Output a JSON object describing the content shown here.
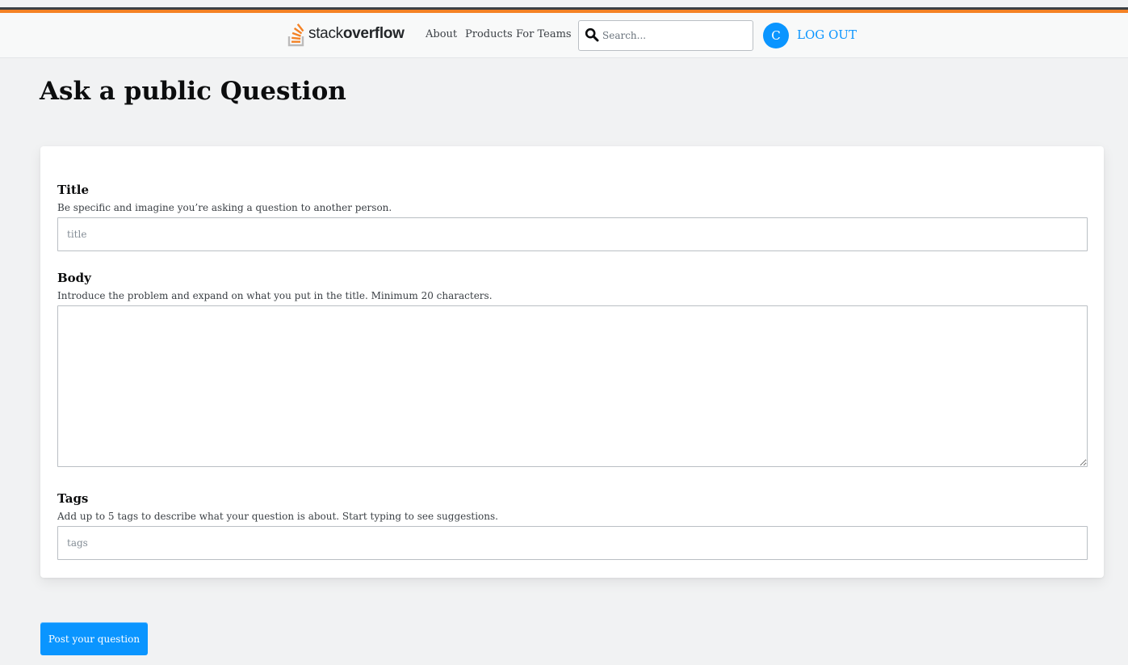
{
  "header": {
    "logo": {
      "regular": "stack",
      "bold": "overflow"
    },
    "nav": [
      "About",
      "Products",
      "For Teams"
    ],
    "search": {
      "placeholder": "Search...",
      "value": ""
    },
    "avatar_letter": "C",
    "logout_label": "LOG OUT"
  },
  "page": {
    "title": "Ask a public Question"
  },
  "form": {
    "title": {
      "label": "Title",
      "description": "Be specific and imagine you’re asking a question to another person.",
      "placeholder": "title"
    },
    "body": {
      "label": "Body",
      "description": "Introduce the problem and expand on what you put in the title. Minimum 20 characters.",
      "placeholder": ""
    },
    "tags": {
      "label": "Tags",
      "description": "Add up to 5 tags to describe what your question is about. Start typing to see suggestions.",
      "placeholder": "tags"
    }
  },
  "actions": {
    "post_label": "Post your question"
  },
  "colors": {
    "brand_orange": "#f48225",
    "accent_blue": "#0a95ff",
    "page_bg": "#f1f2f3"
  }
}
